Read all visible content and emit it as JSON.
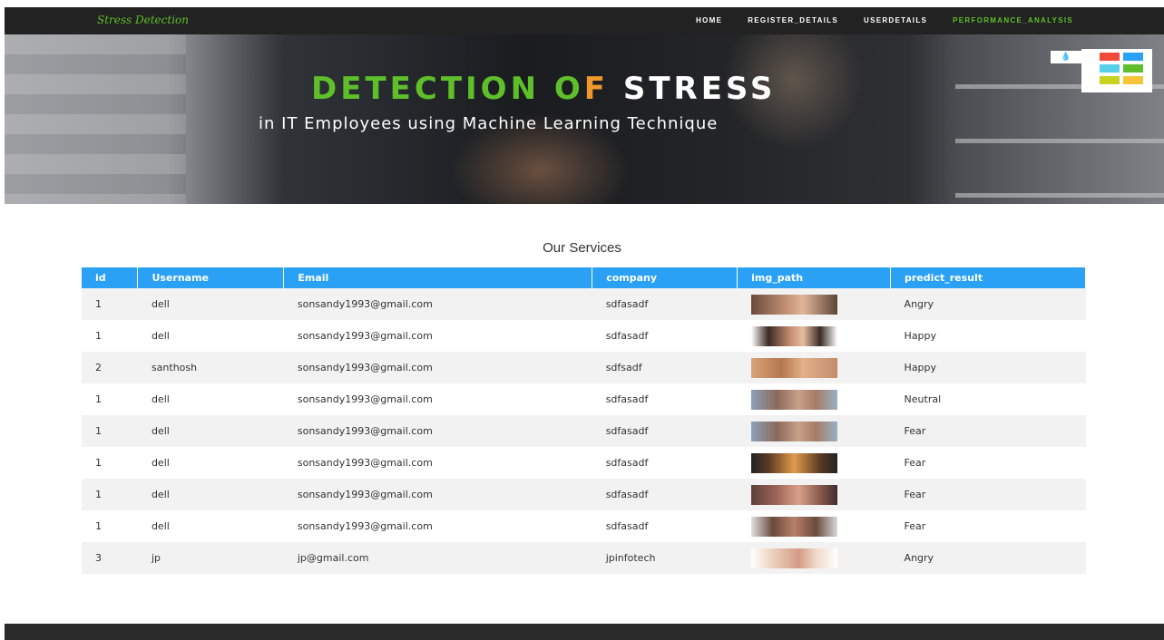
{
  "nav": {
    "brand": "Stress Detection",
    "links": [
      "HOME",
      "REGISTER_DETAILS",
      "USERDETAILS",
      "PERFORMANCE_ANALYSIS"
    ]
  },
  "hero": {
    "title_part1": "DETECTION O",
    "title_part2": "F ",
    "title_part3": "STRESS",
    "subtitle": "in IT Employees using Machine Learning Technique",
    "switcher_icon": "droplet-icon"
  },
  "colors": {
    "accent_green": "#5fbf2a",
    "accent_orange": "#f0972b",
    "table_header": "#2aa1f5",
    "navbar": "#222222",
    "swatches": [
      "#f04a3a",
      "#2aa1f5",
      "#56d0e8",
      "#5fbf2a",
      "#c9d21e",
      "#f5c43a"
    ]
  },
  "section": {
    "title": "Our Services"
  },
  "table": {
    "headers": [
      "id",
      "Username",
      "Email",
      "company",
      "img_path",
      "predict_result"
    ],
    "rows": [
      {
        "id": "1",
        "username": "dell",
        "email": "sonsandy1993@gmail.com",
        "company": "sdfasadf",
        "img": "face-thumbnail",
        "result": "Angry"
      },
      {
        "id": "1",
        "username": "dell",
        "email": "sonsandy1993@gmail.com",
        "company": "sdfasadf",
        "img": "face-thumbnail",
        "result": "Happy"
      },
      {
        "id": "2",
        "username": "santhosh",
        "email": "sonsandy1993@gmail.com",
        "company": "sdfsadf",
        "img": "face-thumbnail",
        "result": "Happy"
      },
      {
        "id": "1",
        "username": "dell",
        "email": "sonsandy1993@gmail.com",
        "company": "sdfasadf",
        "img": "face-thumbnail",
        "result": "Neutral"
      },
      {
        "id": "1",
        "username": "dell",
        "email": "sonsandy1993@gmail.com",
        "company": "sdfasadf",
        "img": "face-thumbnail",
        "result": "Fear"
      },
      {
        "id": "1",
        "username": "dell",
        "email": "sonsandy1993@gmail.com",
        "company": "sdfasadf",
        "img": "face-thumbnail",
        "result": "Fear"
      },
      {
        "id": "1",
        "username": "dell",
        "email": "sonsandy1993@gmail.com",
        "company": "sdfasadf",
        "img": "face-thumbnail",
        "result": "Fear"
      },
      {
        "id": "1",
        "username": "dell",
        "email": "sonsandy1993@gmail.com",
        "company": "sdfasadf",
        "img": "face-thumbnail",
        "result": "Fear"
      },
      {
        "id": "3",
        "username": "jp",
        "email": "jp@gmail.com",
        "company": "jpinfotech",
        "img": "face-thumbnail",
        "result": "Angry"
      }
    ]
  }
}
